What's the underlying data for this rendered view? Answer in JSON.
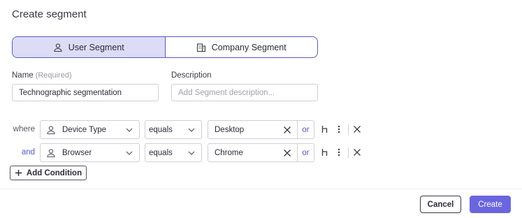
{
  "dialog": {
    "title": "Create segment"
  },
  "segment_type": {
    "options": [
      {
        "label": "User Segment",
        "icon": "user-icon",
        "selected": true
      },
      {
        "label": "Company Segment",
        "icon": "building-icon",
        "selected": false
      }
    ]
  },
  "name_field": {
    "label": "Name",
    "required_hint": "(Required)",
    "value": "Technographic segmentation"
  },
  "description_field": {
    "label": "Description",
    "value": "",
    "placeholder": "Add Segment description..."
  },
  "conditions": [
    {
      "connector": "where",
      "property": "Device Type",
      "property_icon": "user-icon",
      "operator": "equals",
      "value": "Desktop",
      "or_label": "or"
    },
    {
      "connector": "and",
      "property": "Browser",
      "property_icon": "user-icon",
      "operator": "equals",
      "value": "Chrome",
      "or_label": "or"
    }
  ],
  "add_condition_label": "Add Condition",
  "footer": {
    "cancel_label": "Cancel",
    "create_label": "Create"
  },
  "colors": {
    "accent": "#6a66e0",
    "accent_border": "#5a57c8",
    "selected_bg": "#dcdcf7"
  }
}
